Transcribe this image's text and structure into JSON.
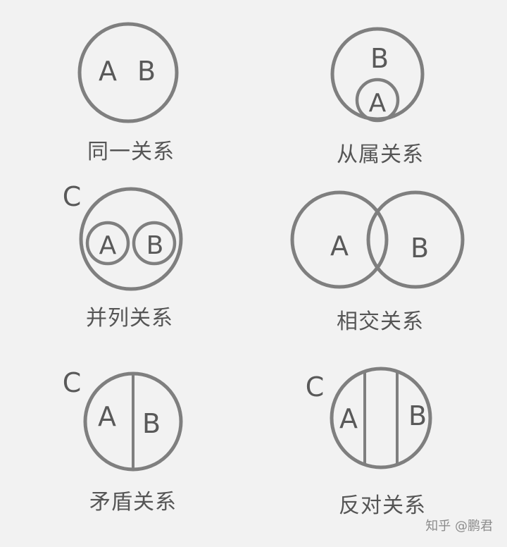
{
  "colors": {
    "background": "#f2f2f2",
    "stroke": "#7f7f7f",
    "letter": "#595959",
    "caption": "#555555"
  },
  "panels": {
    "identity": {
      "caption": "同一关系",
      "a": "A",
      "b": "B"
    },
    "subordination": {
      "caption": "从属关系",
      "a": "A",
      "b": "B"
    },
    "parallel": {
      "caption": "并列关系",
      "a": "A",
      "b": "B",
      "c": "C"
    },
    "intersection": {
      "caption": "相交关系",
      "a": "A",
      "b": "B"
    },
    "contradiction": {
      "caption": "矛盾关系",
      "a": "A",
      "b": "B",
      "c": "C"
    },
    "contrary": {
      "caption": "反对关系",
      "a": "A",
      "b": "B",
      "c": "C"
    }
  },
  "watermark": {
    "text": "知乎 @鹏君"
  }
}
